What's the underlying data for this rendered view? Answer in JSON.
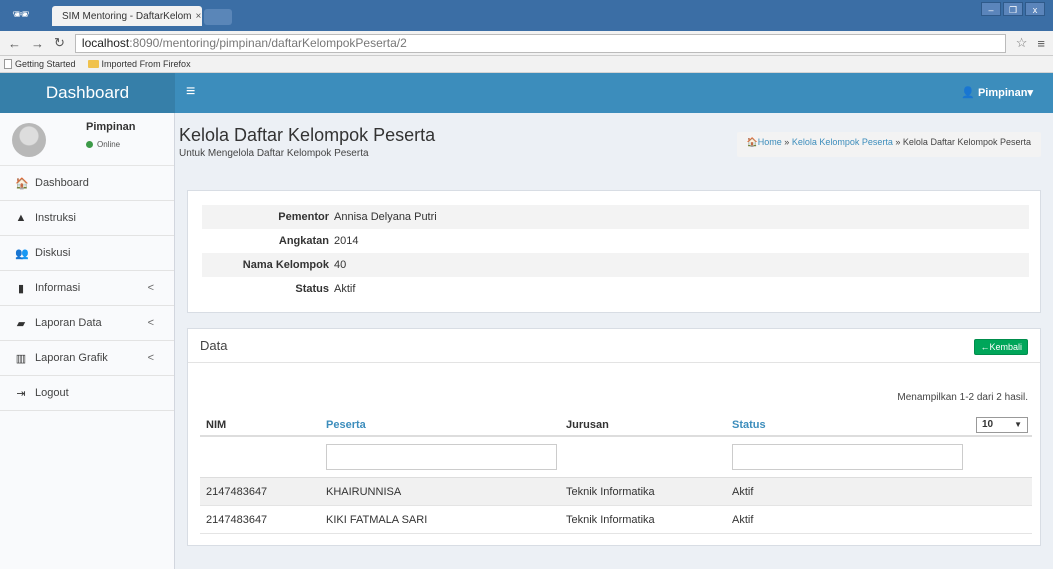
{
  "browser": {
    "tab_title": "SIM Mentoring - DaftarKelom",
    "tab_close": "×",
    "url_host": "localhost",
    "url_path": ":8090/mentoring/pimpinan/daftarKelompokPeserta/2",
    "bookmarks": [
      "Getting Started",
      "Imported From Firefox"
    ]
  },
  "header": {
    "logo": "Dashboard",
    "menu_icon": "≡",
    "user_label": "Pimpinan",
    "user_caret": "▾"
  },
  "sidebar": {
    "user_name": "Pimpinan",
    "user_status": "Online",
    "items": [
      {
        "label": "Dashboard",
        "icon": "home-icon",
        "glyph": "🏠",
        "has_arrow": false
      },
      {
        "label": "Instruksi",
        "icon": "warning-icon",
        "glyph": "▲",
        "has_arrow": false
      },
      {
        "label": "Diskusi",
        "icon": "users-icon",
        "glyph": "👥",
        "has_arrow": false
      },
      {
        "label": "Informasi",
        "icon": "file-icon",
        "glyph": "▮",
        "has_arrow": true
      },
      {
        "label": "Laporan Data",
        "icon": "book-icon",
        "glyph": "▰",
        "has_arrow": true
      },
      {
        "label": "Laporan Grafik",
        "icon": "bar-chart-icon",
        "glyph": "▥",
        "has_arrow": true
      },
      {
        "label": "Logout",
        "icon": "sign-out-icon",
        "glyph": "⇥",
        "has_arrow": false
      }
    ],
    "arrow": "<"
  },
  "page": {
    "title": "Kelola Daftar Kelompok Peserta",
    "subtitle": "Untuk Mengelola Daftar Kelompok Peserta",
    "breadcrumb": {
      "home": "Home",
      "sep": "»",
      "link": "Kelola Kelompok Peserta",
      "current": "Kelola Daftar Kelompok Peserta"
    }
  },
  "detail": [
    {
      "key": "Pementor",
      "value": "Annisa Delyana Putri"
    },
    {
      "key": "Angkatan",
      "value": "2014"
    },
    {
      "key": "Nama Kelompok",
      "value": "40"
    },
    {
      "key": "Status",
      "value": "Aktif"
    }
  ],
  "data_box": {
    "title": "Data",
    "back_label": "Kembali",
    "summary": "Menampilkan 1-2 dari 2 hasil.",
    "per_page": "10",
    "columns": [
      "NIM",
      "Peserta",
      "Jurusan",
      "Status"
    ],
    "rows": [
      [
        "2147483647",
        "KHAIRUNNISA",
        "Teknik Informatika",
        "Aktif"
      ],
      [
        "2147483647",
        "KIKI FATMALA SARI",
        "Teknik Informatika",
        "Aktif"
      ]
    ]
  },
  "colors": {
    "header": "#3c8dbc",
    "logo_bg": "#367fa9",
    "success": "#00a65a",
    "link": "#3c8dbc"
  }
}
